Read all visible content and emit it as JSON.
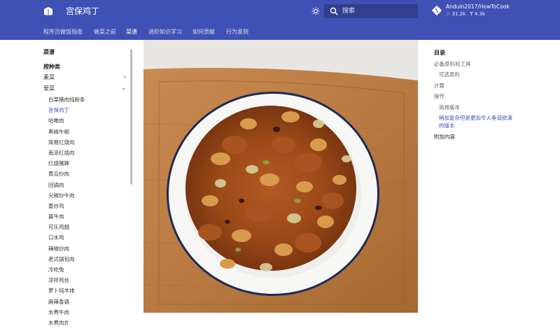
{
  "header": {
    "title": "宫保鸡丁",
    "search_placeholder": "搜索",
    "repo": {
      "name": "Anduin2017/HowToCook",
      "stars": "☆ 31.2k",
      "forks": "Ɏ 4.3k"
    }
  },
  "tabs": [
    {
      "label": "程序员做饭指南"
    },
    {
      "label": "做菜之前"
    },
    {
      "label": "菜谱"
    },
    {
      "label": "进阶知识学习"
    },
    {
      "label": "如何贡献"
    },
    {
      "label": "行为准则"
    }
  ],
  "nav": {
    "title": "菜谱",
    "section": "按种类",
    "groups": [
      {
        "label": "素菜",
        "expanded": false
      },
      {
        "label": "荤菜",
        "expanded": true
      }
    ],
    "items": [
      "白菜猪肉炖粉条",
      "宫保鸡丁",
      "咕噜肉",
      "黑椒牛柳",
      "简易红烧肉",
      "南派红烧肉",
      "红烧猪蹄",
      "黄瓜炒肉",
      "回锅肉",
      "尖椒炒牛肉",
      "姜炒鸡",
      "酱牛肉",
      "可乐鸡翅",
      "口水鸡",
      "辣椒炒肉",
      "老式锅包肉",
      "冷吃兔",
      "凉拌鸡丝",
      "萝卜炖羊排",
      "麻辣香锅",
      "水煮牛肉",
      "水煮肉片"
    ],
    "active_item": "宫保鸡丁"
  },
  "toc": {
    "title": "目录",
    "items": [
      {
        "label": "必备原料和工具"
      },
      {
        "label": "可选原料"
      },
      {
        "label": "计算"
      },
      {
        "label": "操作"
      },
      {
        "label": "简易版本"
      },
      {
        "label": "稍加复杂但是更加令人垂涎欲滴"
      },
      {
        "label": "的版本"
      },
      {
        "label": "附加内容"
      }
    ]
  },
  "colors": {
    "primary": "#4051b5",
    "active_link": "#4051b5"
  }
}
